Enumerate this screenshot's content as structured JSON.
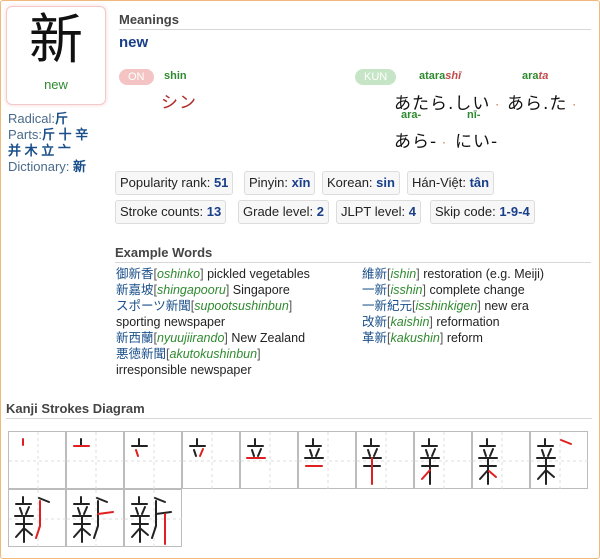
{
  "kanji": {
    "character": "新",
    "meaning": "new"
  },
  "info": {
    "radical_label": "Radical:",
    "radical_value": "斤",
    "parts_label": "Parts:",
    "parts_value_line1": "斤 十 辛",
    "parts_value_line2": "并 木 立 亠",
    "dictionary_label": "Dictionary:",
    "dictionary_value": "新"
  },
  "meanings": {
    "title": "Meanings",
    "value": "new"
  },
  "readings": {
    "on_badge": "ON",
    "on_romaji": "shin",
    "on_kana": "シン",
    "kun_badge": "KUN",
    "kun1_romaji": "atara",
    "kun1_romaji_okurigana": "shī",
    "kun1_kana": "あたら.しい",
    "kun2_romaji": "ara",
    "kun2_romaji_okurigana": "ta",
    "kun2_kana": "あら.た",
    "kun3_romaji": "ara-",
    "kun3_kana": "あら-",
    "kun4_romaji": "nī-",
    "kun4_kana": "にい-"
  },
  "stats": [
    {
      "label": "Popularity rank:",
      "value": "51"
    },
    {
      "label": "Pinyin:",
      "value": "xīn"
    },
    {
      "label": "Korean:",
      "value": "sin"
    },
    {
      "label": "Hán-Việt:",
      "value": "tân"
    },
    {
      "label": "Stroke counts:",
      "value": "13"
    },
    {
      "label": "Grade level:",
      "value": "2"
    },
    {
      "label": "JLPT level:",
      "value": "4"
    },
    {
      "label": "Skip code:",
      "value": "1-9-4"
    }
  ],
  "examples": {
    "title": "Example Words",
    "left": [
      {
        "kanji": "御新香",
        "romaji": "oshinko",
        "meaning": "pickled vegetables",
        "wrap": ""
      },
      {
        "kanji": "新嘉坡",
        "romaji": "shingapooru",
        "meaning": "Singapore",
        "wrap": ""
      },
      {
        "kanji": "スポーツ新聞",
        "romaji": "supootsushinbun",
        "meaning": "",
        "wrap": "sporting newspaper"
      },
      {
        "kanji": "新西蘭",
        "romaji": "nyuujiirando",
        "meaning": "New Zealand",
        "wrap": ""
      },
      {
        "kanji": "悪徳新聞",
        "romaji": "akutokushinbun",
        "meaning": "",
        "wrap": "irresponsible newspaper"
      }
    ],
    "right": [
      {
        "kanji": "維新",
        "romaji": "ishin",
        "meaning": "restoration (e.g. Meiji)"
      },
      {
        "kanji": "一新",
        "romaji": "isshin",
        "meaning": "complete change"
      },
      {
        "kanji": "一新紀元",
        "romaji": "isshinkigen",
        "meaning": "new era"
      },
      {
        "kanji": "改新",
        "romaji": "kaishin",
        "meaning": "reformation"
      },
      {
        "kanji": "革新",
        "romaji": "kakushin",
        "meaning": "reform"
      }
    ]
  },
  "strokes": {
    "title": "Kanji Strokes Diagram",
    "count": 13
  }
}
